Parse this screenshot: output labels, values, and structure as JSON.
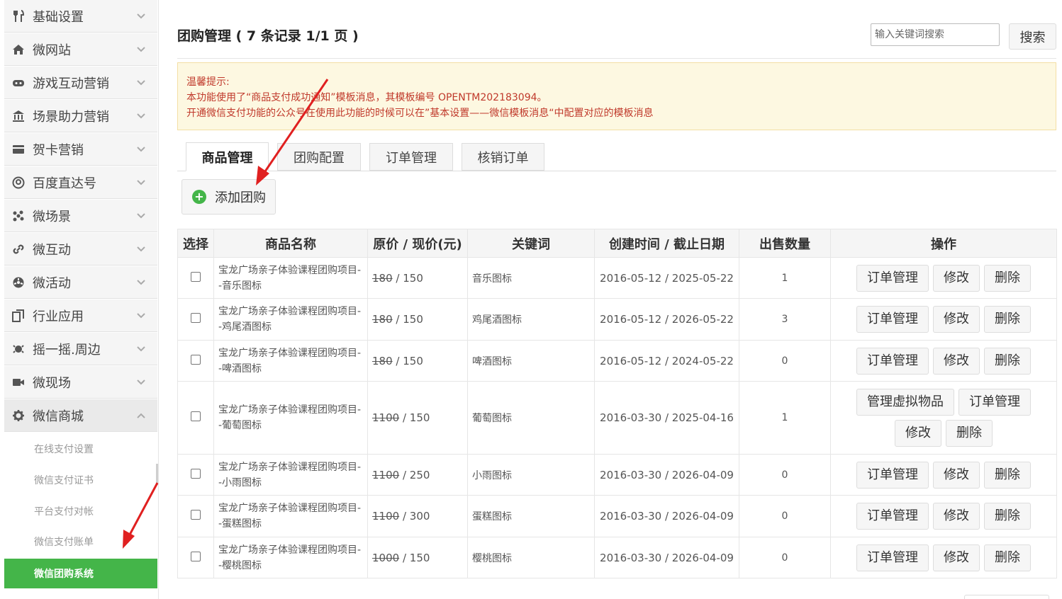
{
  "sidebar": {
    "items": [
      {
        "label": "基础设置",
        "icon": "fork-knife-icon"
      },
      {
        "label": "微网站",
        "icon": "home-icon"
      },
      {
        "label": "游戏互动营销",
        "icon": "gamepad-icon"
      },
      {
        "label": "场景助力营销",
        "icon": "bank-icon"
      },
      {
        "label": "贺卡营销",
        "icon": "card-icon"
      },
      {
        "label": "百度直达号",
        "icon": "user-circle-icon"
      },
      {
        "label": "微场景",
        "icon": "molecule-icon"
      },
      {
        "label": "微互动",
        "icon": "link-icon"
      },
      {
        "label": "微活动",
        "icon": "fan-icon"
      },
      {
        "label": "行业应用",
        "icon": "pages-icon"
      },
      {
        "label": "摇一摇.周边",
        "icon": "shake-icon"
      },
      {
        "label": "微现场",
        "icon": "video-icon"
      },
      {
        "label": "微信商城",
        "icon": "gear-icon"
      }
    ],
    "sub_items": [
      {
        "label": "在线支付设置"
      },
      {
        "label": "微信支付证书"
      },
      {
        "label": "平台支付对帐"
      },
      {
        "label": "微信支付账单"
      },
      {
        "label": "微信团购系统"
      }
    ]
  },
  "header": {
    "title": "团购管理 ( 7 条记录 1/1 页 )",
    "search_placeholder": "输入关键词搜索",
    "search_button": "搜索"
  },
  "notice": {
    "line1": "温馨提示:",
    "line2": "本功能使用了“商品支付成功通知”模板消息，其模板编号 OPENTM202183094。",
    "line3": "开通微信支付功能的公众号在使用此功能的时候可以在”基本设置——微信模板消息“中配置对应的模板消息"
  },
  "tabs": [
    "商品管理",
    "团购配置",
    "订单管理",
    "核销订单"
  ],
  "add_button": "添加团购",
  "table": {
    "headers": [
      "选择",
      "商品名称",
      "原价 / 现价(元)",
      "关键词",
      "创建时间 / 截止日期",
      "出售数量",
      "操作"
    ],
    "rows": [
      {
        "name": "宝龙广场亲子体验课程团购项目--音乐图标",
        "orig": "180",
        "price": " / 150",
        "keyword": "音乐图标",
        "dates": "2016-05-12 / 2025-05-22",
        "sold": "1"
      },
      {
        "name": "宝龙广场亲子体验课程团购项目--鸡尾酒图标",
        "orig": "180",
        "price": " / 150",
        "keyword": "鸡尾酒图标",
        "dates": "2016-05-12 / 2026-05-22",
        "sold": "3"
      },
      {
        "name": "宝龙广场亲子体验课程团购项目--啤酒图标",
        "orig": "180",
        "price": " / 150",
        "keyword": "啤酒图标",
        "dates": "2016-05-12 / 2024-05-22",
        "sold": "0"
      },
      {
        "name": "宝龙广场亲子体验课程团购项目--葡萄图标",
        "orig": "1100",
        "price": " / 150",
        "keyword": "葡萄图标",
        "dates": "2016-03-30 / 2025-04-16",
        "sold": "1"
      },
      {
        "name": "宝龙广场亲子体验课程团购项目--小雨图标",
        "orig": "1100",
        "price": " / 250",
        "keyword": "小雨图标",
        "dates": "2016-03-30 / 2026-04-09",
        "sold": "0"
      },
      {
        "name": "宝龙广场亲子体验课程团购项目--蛋糕图标",
        "orig": "1100",
        "price": " / 300",
        "keyword": "蛋糕图标",
        "dates": "2016-03-30 / 2026-04-09",
        "sold": "0"
      },
      {
        "name": "宝龙广场亲子体验课程团购项目--樱桃图标",
        "orig": "1000",
        "price": " / 150",
        "keyword": "樱桃图标",
        "dates": "2016-03-30 / 2026-04-09",
        "sold": "0"
      }
    ],
    "ops": {
      "orders": "订单管理",
      "edit": "修改",
      "delete": "删除",
      "virtual": "管理虚拟物品"
    }
  },
  "colors": {
    "accent": "#44b549",
    "notice_text": "#c0392b",
    "notice_bg": "#fdf8e1",
    "arrow": "#e02020"
  }
}
